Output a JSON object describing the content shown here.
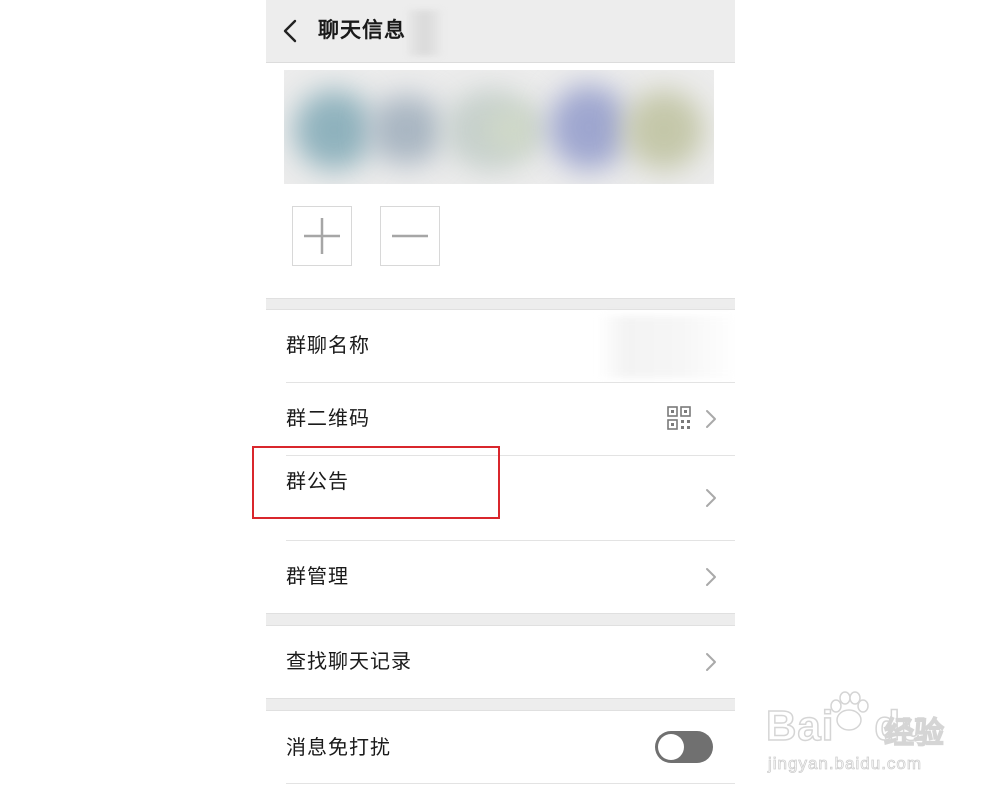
{
  "header": {
    "title": "聊天信息",
    "back_icon": "chevron-left-icon"
  },
  "members": {
    "add_icon": "plus-icon",
    "remove_icon": "minus-icon"
  },
  "settings": {
    "group_name_label": "群聊名称",
    "group_qr_label": "群二维码",
    "group_notice_label": "群公告",
    "group_manage_label": "群管理",
    "search_history_label": "查找聊天记录",
    "mute_label": "消息免打扰",
    "mute_enabled": false
  },
  "annotation": {
    "highlight_color": "#d9262c"
  },
  "watermark": {
    "brand": "Bai",
    "brand_suffix": "du",
    "product": "经验",
    "url": "jingyan.baidu.com"
  }
}
